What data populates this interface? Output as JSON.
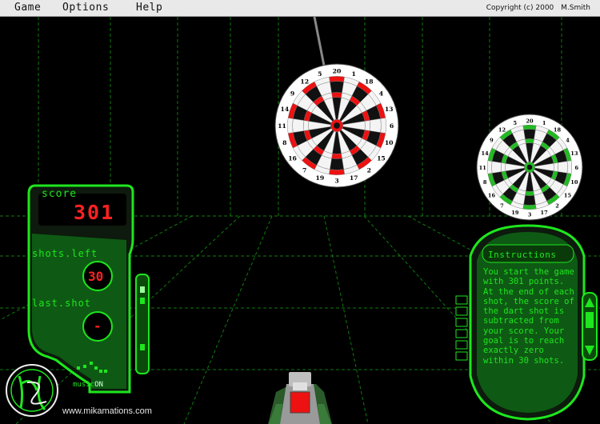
{
  "menu": {
    "items": [
      "Game",
      "Options",
      "Help"
    ],
    "copyright": "Copyright (c) 2000",
    "author": "M.Smith"
  },
  "hud": {
    "score_label": "score",
    "score_value": "301",
    "shots_left_label": "shots.left",
    "shots_left_value": "30",
    "last_shot_label": "last.shot",
    "last_shot_value": "-",
    "music_label": "music",
    "music_state": "ON"
  },
  "instructions": {
    "title": "Instructions",
    "text": "You start the game with 301 points. At the end of each shot, the score of the dart shot is subtracted from your score. Your goal is to reach exactly zero within 30 shots."
  },
  "logo": {
    "initials": "MS"
  },
  "website": "www.mikamations.com",
  "dartboard_numbers": [
    "20",
    "1",
    "18",
    "4",
    "13",
    "6",
    "10",
    "15",
    "2",
    "17",
    "3",
    "19",
    "7",
    "16",
    "8",
    "11",
    "14",
    "9",
    "12",
    "5"
  ],
  "colors": {
    "accent": "#1ee61e",
    "red": "#ee1111",
    "board_green": "#22bb22"
  }
}
